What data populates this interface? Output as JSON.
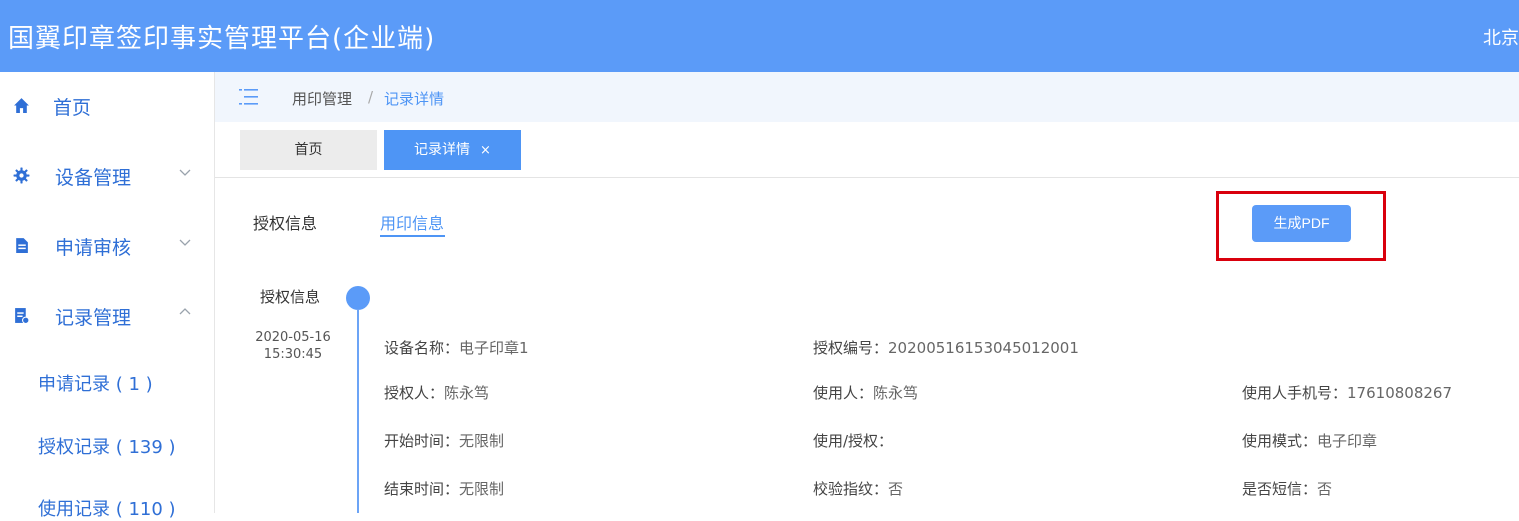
{
  "header": {
    "title": "国翼印章签印事实管理平台(企业端)",
    "user_partial": "北京"
  },
  "sidebar": {
    "items": [
      {
        "label": "首页",
        "icon": "home-icon"
      },
      {
        "label": "设备管理",
        "icon": "gear-icon"
      },
      {
        "label": "申请审核",
        "icon": "document-icon"
      },
      {
        "label": "记录管理",
        "icon": "record-icon"
      }
    ],
    "record_subitems": [
      {
        "label": "申请记录 ( 1 )"
      },
      {
        "label": "授权记录 ( 139 )"
      },
      {
        "label": "使用记录 ( 110 )"
      }
    ]
  },
  "breadcrumb": {
    "parent": "用印管理",
    "separator": "/",
    "current": "记录详情"
  },
  "tabs": {
    "home": "首页",
    "detail": "记录详情",
    "close": "×"
  },
  "subtabs": {
    "auth_info": "授权信息",
    "seal_info": "用印信息",
    "active": "用印信息"
  },
  "actions": {
    "generate_pdf": "生成PDF"
  },
  "timeline": {
    "title": "授权信息",
    "date": "2020-05-16",
    "time": "15:30:45"
  },
  "details": {
    "device_name": {
      "label": "设备名称：",
      "value": "电子印章1"
    },
    "auth_no": {
      "label": "授权编号：",
      "value": "20200516153045012001"
    },
    "authorizer": {
      "label": "授权人：",
      "value": "陈永笃"
    },
    "user": {
      "label": "使用人：",
      "value": "陈永笃"
    },
    "phone": {
      "label": "使用人手机号：",
      "value": "17610808267"
    },
    "start_time": {
      "label": "开始时间：",
      "value": "无限制"
    },
    "use_auth": {
      "label": "使用/授权：",
      "value": ""
    },
    "use_mode": {
      "label": "使用模式：",
      "value": "电子印章"
    },
    "end_time": {
      "label": "结束时间：",
      "value": "无限制"
    },
    "fingerprint": {
      "label": "校验指纹：",
      "value": "否"
    },
    "sms": {
      "label": "是否短信：",
      "value": "否"
    }
  },
  "colors": {
    "primary": "#5b9bf8",
    "highlight_border": "#d9000d",
    "link": "#2f6fd6"
  }
}
